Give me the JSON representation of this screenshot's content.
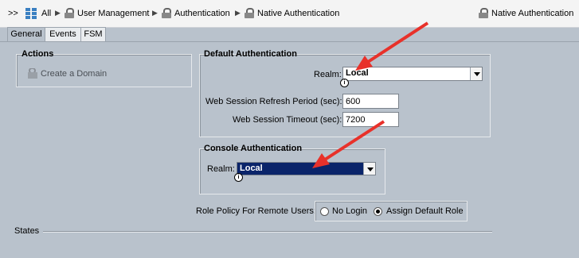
{
  "breadcrumb": {
    "expand": ">>",
    "items": [
      "All",
      "User Management",
      "Authentication",
      "Native Authentication"
    ],
    "right_title": "Native Authentication"
  },
  "tabs": [
    "General",
    "Events",
    "FSM"
  ],
  "actions": {
    "title": "Actions",
    "create_domain": "Create a Domain"
  },
  "default_auth": {
    "title": "Default Authentication",
    "realm_label": "Realm:",
    "realm_value": "Local",
    "refresh_label": "Web Session Refresh Period (sec):",
    "refresh_value": "600",
    "timeout_label": "Web Session Timeout (sec):",
    "timeout_value": "7200"
  },
  "console_auth": {
    "title": "Console Authentication",
    "realm_label": "Realm:",
    "realm_value": "Local"
  },
  "role_policy": {
    "label": "Role Policy For Remote Users:",
    "options": [
      "No Login",
      "Assign Default Role"
    ],
    "selected": "Assign Default Role"
  },
  "states": {
    "title": "States"
  },
  "colors": {
    "panel": "#b9c2cc",
    "selected_select": "#0a246a",
    "arrow": "#e8312a"
  },
  "icons": {
    "info": "i",
    "tree": "tree-icon",
    "lock": "lock-icon"
  }
}
